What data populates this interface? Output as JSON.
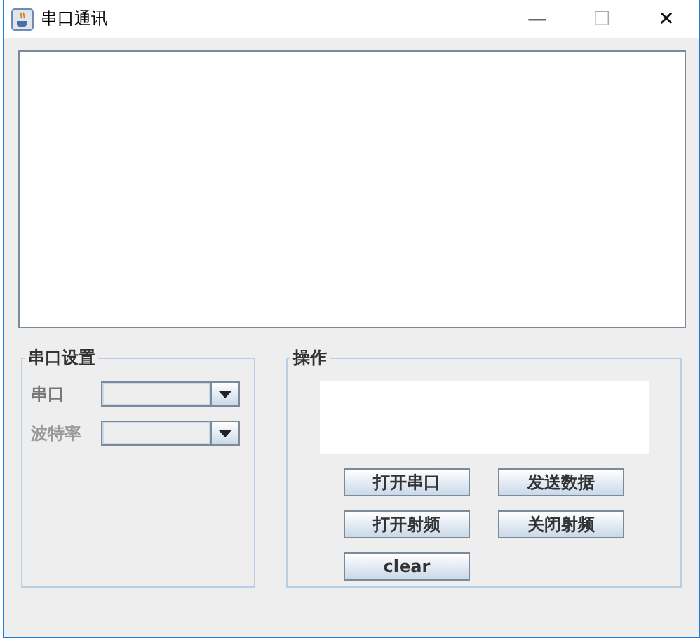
{
  "window": {
    "title": "串口通讯",
    "controls": [
      "—",
      "☐",
      "✕"
    ]
  },
  "serial_settings": {
    "title": "串口设置",
    "fields": [
      {
        "label": "串口"
      },
      {
        "label": "波特率"
      }
    ]
  },
  "operations": {
    "title": "操作",
    "buttons": [
      "打开串口",
      "发送数据",
      "打开射频",
      "关闭射频",
      "clear"
    ]
  }
}
